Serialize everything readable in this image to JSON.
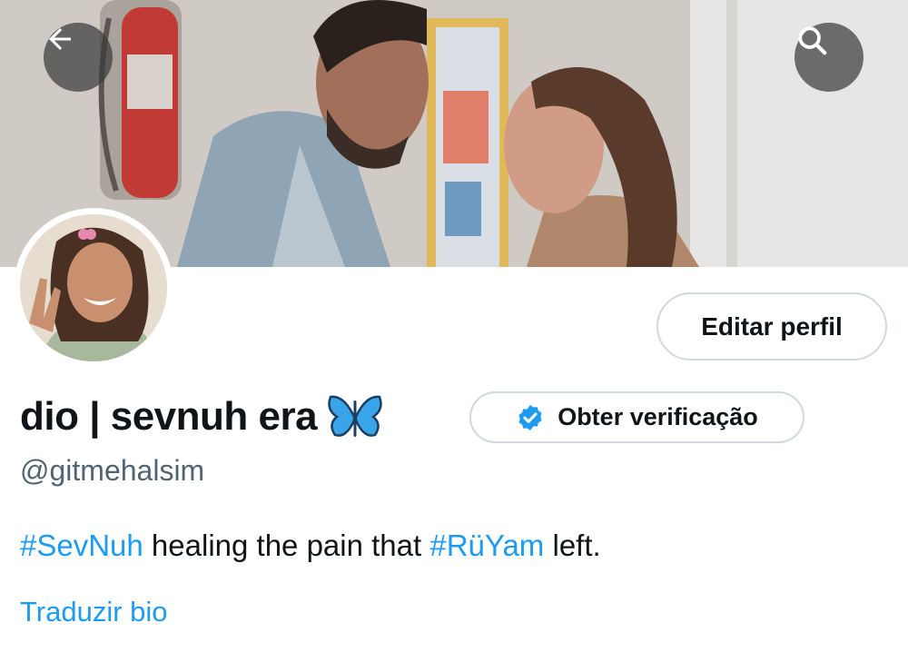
{
  "header": {
    "back_icon": "arrow-left-icon",
    "search_icon": "search-icon"
  },
  "profile": {
    "display_name": "dio | sevnuh era",
    "name_emoji": "butterfly-icon",
    "handle": "@gitmehalsim",
    "edit_profile_label": "Editar perfil",
    "verification_label": "Obter verificação",
    "verification_icon": "verified-badge-icon",
    "bio": {
      "hashtag1": "#SevNuh",
      "text1": " healing the pain that ",
      "hashtag2": "#RüYam",
      "text2": " left."
    },
    "translate_bio_label": "Traduzir bio"
  },
  "colors": {
    "accent": "#1d9bf0",
    "secondary_text": "#536471",
    "primary_text": "#0f1419",
    "border": "#cfd9de"
  }
}
